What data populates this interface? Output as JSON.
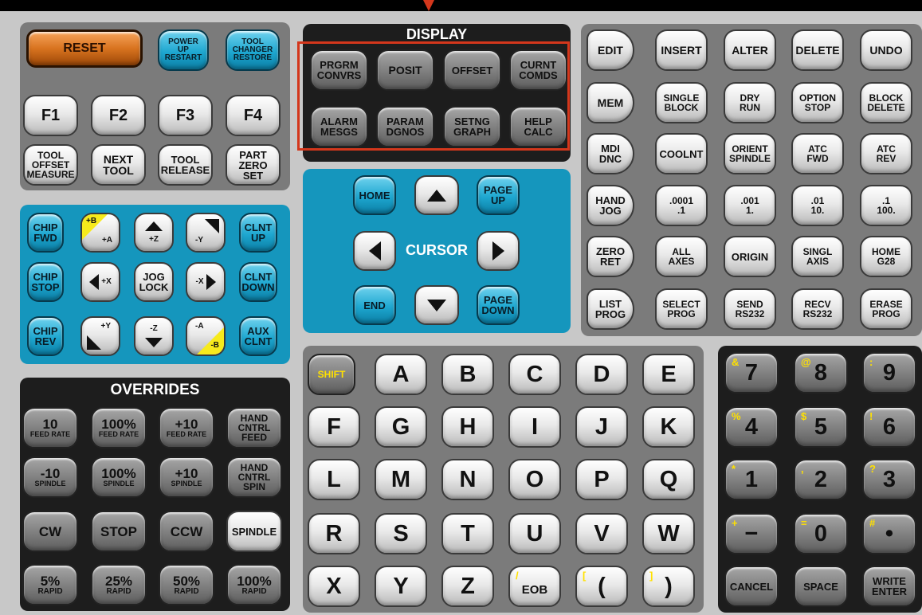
{
  "display_title": "DISPLAY",
  "overrides_title": "OVERRIDES",
  "cursor_label": "CURSOR",
  "top_left": {
    "reset": "RESET",
    "power_up": [
      "POWER",
      "UP",
      "RESTART"
    ],
    "tool_changer": [
      "TOOL",
      "CHANGER",
      "RESTORE"
    ],
    "f1": "F1",
    "f2": "F2",
    "f3": "F3",
    "f4": "F4",
    "tool_offset": [
      "TOOL",
      "OFFSET",
      "MEASURE"
    ],
    "next_tool": [
      "NEXT",
      "TOOL"
    ],
    "tool_release": [
      "TOOL",
      "RELEASE"
    ],
    "part_zero": [
      "PART",
      "ZERO",
      "SET"
    ]
  },
  "display_keys": {
    "prgrm": [
      "PRGRM",
      "CONVRS"
    ],
    "posit": "POSIT",
    "offset": "OFFSET",
    "curnt": [
      "CURNT",
      "COMDS"
    ],
    "alarm": [
      "ALARM",
      "MESGS"
    ],
    "param": [
      "PARAM",
      "DGNOS"
    ],
    "setng": [
      "SETNG",
      "GRAPH"
    ],
    "help": [
      "HELP",
      "CALC"
    ]
  },
  "cursor_keys": {
    "home": "HOME",
    "page_up": [
      "PAGE",
      "UP"
    ],
    "end": "END",
    "page_down": [
      "PAGE",
      "DOWN"
    ]
  },
  "jog": {
    "chip_fwd": [
      "CHIP",
      "FWD"
    ],
    "plus_b": "+B",
    "plus_a": "+A",
    "plus_z": "+Z",
    "minus_y": "-Y",
    "clnt_up": [
      "CLNT",
      "UP"
    ],
    "chip_stop": [
      "CHIP",
      "STOP"
    ],
    "plus_x": "+X",
    "jog_lock": [
      "JOG",
      "LOCK"
    ],
    "minus_x": "-X",
    "clnt_down": [
      "CLNT",
      "DOWN"
    ],
    "chip_rev": [
      "CHIP",
      "REV"
    ],
    "plus_y": "+Y",
    "minus_z": "-Z",
    "minus_a": "-A",
    "minus_b": "-B",
    "aux_clnt": [
      "AUX",
      "CLNT"
    ]
  },
  "overrides": {
    "row1": [
      {
        "big": "10",
        "small": "FEED RATE"
      },
      {
        "big": "100%",
        "small": "FEED RATE"
      },
      {
        "big": "+10",
        "small": "FEED RATE"
      }
    ],
    "hand_feed": [
      "HAND",
      "CNTRL",
      "FEED"
    ],
    "row2": [
      {
        "big": "-10",
        "small": "SPINDLE"
      },
      {
        "big": "100%",
        "small": "SPINDLE"
      },
      {
        "big": "+10",
        "small": "SPINDLE"
      }
    ],
    "hand_spin": [
      "HAND",
      "CNTRL",
      "SPIN"
    ],
    "cw": "CW",
    "stop": "STOP",
    "ccw": "CCW",
    "spindle": "SPINDLE",
    "row4": [
      {
        "big": "5%",
        "small": "RAPID"
      },
      {
        "big": "25%",
        "small": "RAPID"
      },
      {
        "big": "50%",
        "small": "RAPID"
      },
      {
        "big": "100%",
        "small": "RAPID"
      }
    ]
  },
  "modes": {
    "edit": "EDIT",
    "mem": "MEM",
    "mdi": [
      "MDI",
      "DNC"
    ],
    "hand_jog": [
      "HAND",
      "JOG"
    ],
    "zero_ret": [
      "ZERO",
      "RET"
    ],
    "list_prog": [
      "LIST",
      "PROG"
    ],
    "insert": "INSERT",
    "alter": "ALTER",
    "delete": "DELETE",
    "undo": "UNDO",
    "single_block": [
      "SINGLE",
      "BLOCK"
    ],
    "dry_run": [
      "DRY",
      "RUN"
    ],
    "option_stop": [
      "OPTION",
      "STOP"
    ],
    "block_delete": [
      "BLOCK",
      "DELETE"
    ],
    "coolnt": "COOLNT",
    "orient_spindle": [
      "ORIENT",
      "SPINDLE"
    ],
    "atc_fwd": [
      "ATC",
      "FWD"
    ],
    "atc_rev": [
      "ATC",
      "REV"
    ],
    "hj1": [
      ".0001",
      ".1"
    ],
    "hj2": [
      ".001",
      "1."
    ],
    "hj3": [
      ".01",
      "10."
    ],
    "hj4": [
      ".1",
      "100."
    ],
    "all_axes": [
      "ALL",
      "AXES"
    ],
    "origin": "ORIGIN",
    "singl_axis": [
      "SINGL",
      "AXIS"
    ],
    "home_g28": [
      "HOME",
      "G28"
    ],
    "select_prog": [
      "SELECT",
      "PROG"
    ],
    "send_rs232": [
      "SEND",
      "RS232"
    ],
    "recv_rs232": [
      "RECV",
      "RS232"
    ],
    "erase_prog": [
      "ERASE",
      "PROG"
    ]
  },
  "alpha": {
    "shift": "SHIFT",
    "row1": [
      "A",
      "B",
      "C",
      "D",
      "E"
    ],
    "row2": [
      "F",
      "G",
      "H",
      "I",
      "J",
      "K"
    ],
    "row3": [
      "L",
      "M",
      "N",
      "O",
      "P",
      "Q"
    ],
    "row4": [
      "R",
      "S",
      "T",
      "U",
      "V",
      "W"
    ],
    "x": "X",
    "y": "Y",
    "z": "Z",
    "eob": "EOB",
    "eob_alt": "/",
    "lparen": "(",
    "lparen_alt": "[",
    "rparen": ")",
    "rparen_alt": "]"
  },
  "numpad": {
    "keys": [
      {
        "main": "7",
        "alt": "&"
      },
      {
        "main": "8",
        "alt": "@"
      },
      {
        "main": "9",
        "alt": ":"
      },
      {
        "main": "4",
        "alt": "%"
      },
      {
        "main": "5",
        "alt": "$"
      },
      {
        "main": "6",
        "alt": "!"
      },
      {
        "main": "1",
        "alt": "*"
      },
      {
        "main": "2",
        "alt": ","
      },
      {
        "main": "3",
        "alt": "?"
      },
      {
        "main": "−",
        "alt": "+"
      },
      {
        "main": "0",
        "alt": "="
      },
      {
        "main": "•",
        "alt": "#"
      }
    ],
    "cancel": "CANCEL",
    "space": "SPACE",
    "write": "WRITE",
    "enter": "ENTER"
  },
  "colors": {
    "reset": "#d8731f",
    "highlight": "#d4371c",
    "blue_panel": "#1596bd",
    "gray_panel": "#7b7b7b",
    "dark_panel": "#1d1d1d"
  }
}
